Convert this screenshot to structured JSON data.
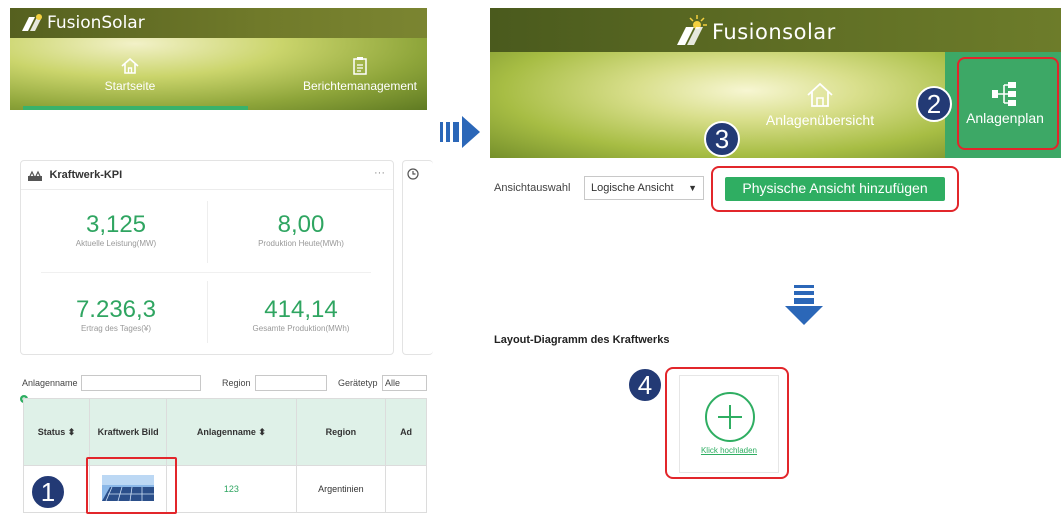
{
  "left_app": {
    "brand": "FusionSolar",
    "nav": [
      {
        "label": "Startseite",
        "icon": "home-icon"
      },
      {
        "label": "Berichtemanagement",
        "icon": "clipboard-icon"
      }
    ]
  },
  "kpi": {
    "title": "Kraftwerk-KPI",
    "menu": "···",
    "items": [
      {
        "value": "3,125",
        "label": "Aktuelle Leistung(MW)"
      },
      {
        "value": "8,00",
        "label": "Produktion Heute(MWh)"
      },
      {
        "value": "7.236,3",
        "label": "Ertrag des Tages(¥)"
      },
      {
        "value": "414,14",
        "label": "Gesamte Produktion(MWh)"
      }
    ]
  },
  "filters": {
    "plant_name_label": "Anlagenname",
    "region_label": "Region",
    "device_type_label": "Gerätetyp",
    "device_type_value": "Alle"
  },
  "table": {
    "headers": [
      "Status ⬍",
      "Kraftwerk Bild",
      "Anlagenname ⬍",
      "Region",
      "Ad"
    ],
    "row": {
      "name": "123",
      "region": "Argentinien"
    }
  },
  "right_app": {
    "brand": "Fusionsolar",
    "nav": [
      {
        "label": "Anlagenübersicht",
        "icon": "home-icon"
      },
      {
        "label": "Anlagenplan",
        "icon": "layout-tree-icon"
      }
    ]
  },
  "view": {
    "label": "Ansichtauswahl",
    "select_value": "Logische Ansicht",
    "add_button": "Physische Ansicht hinzufügen"
  },
  "layout": {
    "title": "Layout-Diagramm des Kraftwerks",
    "upload_label": "Klick hochladen"
  },
  "steps": [
    "1",
    "2",
    "3",
    "4"
  ],
  "colors": {
    "accent_green": "#2fae62",
    "highlight_red": "#e2262b",
    "step_badge": "#233a75",
    "arrow_blue": "#2b67b8"
  }
}
